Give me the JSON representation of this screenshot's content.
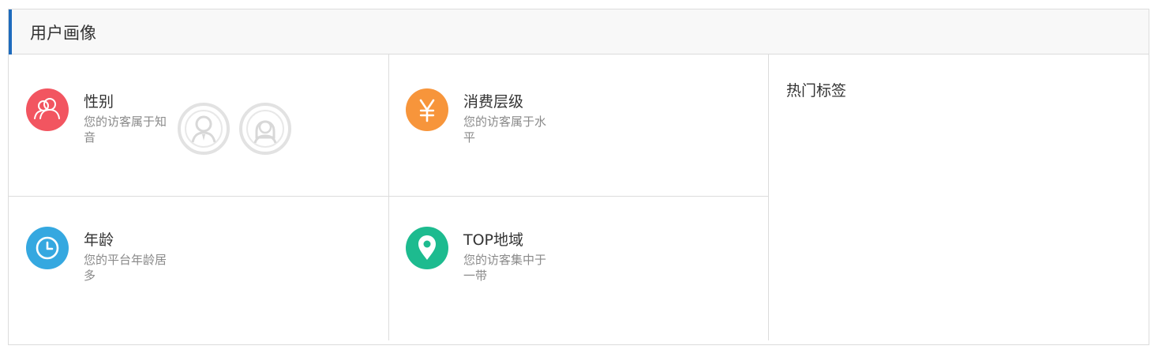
{
  "panel": {
    "title": "用户画像"
  },
  "colors": {
    "accent": "#1e6bbd",
    "gender_icon": "#f25560",
    "spend_icon": "#f7953b",
    "age_icon": "#35a8e0",
    "region_icon": "#1dbb8f"
  },
  "cards": {
    "gender": {
      "icon": "users-icon",
      "title": "性别",
      "desc": "您的访客属于知音"
    },
    "spend": {
      "icon": "yen-icon",
      "title": "消费层级",
      "desc": "您的访客属于水平"
    },
    "age": {
      "icon": "clock-icon",
      "title": "年龄",
      "desc": "您的平台年龄居多"
    },
    "region": {
      "icon": "location-pin-icon",
      "title": "TOP地域",
      "desc": "您的访客集中于一带"
    }
  },
  "tags": {
    "title": "热门标签"
  }
}
